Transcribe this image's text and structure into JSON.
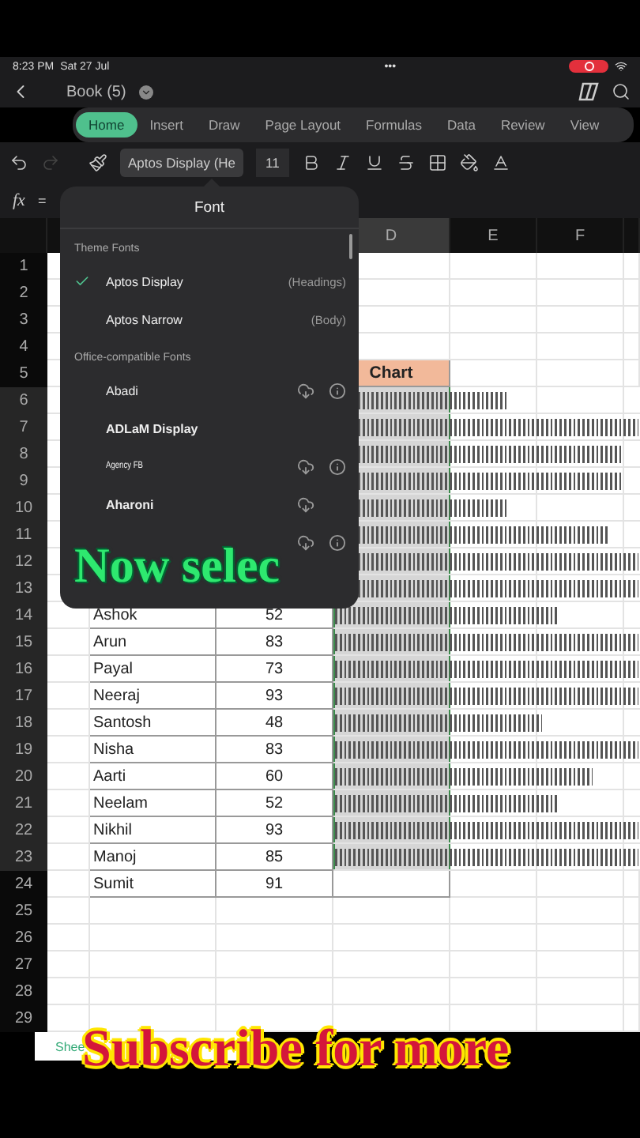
{
  "status_bar": {
    "time": "8:23 PM",
    "date": "Sat 27 Jul",
    "dots": "•••",
    "recording": true
  },
  "title_bar": {
    "title": "Book (5)"
  },
  "ribbon_tabs": [
    {
      "label": "Home",
      "selected": true
    },
    {
      "label": "Insert",
      "selected": false
    },
    {
      "label": "Draw",
      "selected": false
    },
    {
      "label": "Page Layout",
      "selected": false
    },
    {
      "label": "Formulas",
      "selected": false
    },
    {
      "label": "Data",
      "selected": false
    },
    {
      "label": "Review",
      "selected": false
    },
    {
      "label": "View",
      "selected": false
    }
  ],
  "toolbar": {
    "redo_disabled": true,
    "font": "Aptos Display (He",
    "size": "11"
  },
  "formula_bar": {
    "label": "fx",
    "value": "="
  },
  "columns": [
    {
      "letter": "D",
      "selected": true
    },
    {
      "letter": "E",
      "selected": false
    },
    {
      "letter": "F",
      "selected": false
    }
  ],
  "rows": [
    {
      "num": "1",
      "selected": false
    },
    {
      "num": "2",
      "selected": false
    },
    {
      "num": "3",
      "selected": false
    },
    {
      "num": "4",
      "selected": false
    },
    {
      "num": "5",
      "selected": false,
      "header": "Chart"
    },
    {
      "num": "6",
      "selected": true,
      "level": 0.57
    },
    {
      "num": "7",
      "selected": true,
      "level": 1
    },
    {
      "num": "8",
      "selected": true,
      "level": 0.95
    },
    {
      "num": "9",
      "selected": true,
      "level": 0.95
    },
    {
      "num": "10",
      "selected": true,
      "level": 0.57
    },
    {
      "num": "11",
      "selected": true,
      "level": 0.9
    },
    {
      "num": "12",
      "selected": true,
      "level": 1
    },
    {
      "num": "13",
      "selected": true,
      "level": 1
    },
    {
      "num": "14",
      "selected": true,
      "name": "Ashok",
      "score": "52",
      "level": 0.74
    },
    {
      "num": "15",
      "selected": true,
      "name": "Arun",
      "score": "83",
      "level": 1
    },
    {
      "num": "16",
      "selected": true,
      "name": "Payal",
      "score": "73",
      "level": 1
    },
    {
      "num": "17",
      "selected": true,
      "name": "Neeraj",
      "score": "93",
      "level": 1
    },
    {
      "num": "18",
      "selected": true,
      "name": "Santosh",
      "score": "48",
      "level": 0.68
    },
    {
      "num": "19",
      "selected": true,
      "name": "Nisha",
      "score": "83",
      "level": 1
    },
    {
      "num": "20",
      "selected": true,
      "name": "Aarti",
      "score": "60",
      "level": 0.85
    },
    {
      "num": "21",
      "selected": true,
      "name": "Neelam",
      "score": "52",
      "level": 0.74
    },
    {
      "num": "22",
      "selected": true,
      "name": "Nikhil",
      "score": "93",
      "level": 1
    },
    {
      "num": "23",
      "selected": true,
      "name": "Manoj",
      "score": "85",
      "level": 1
    },
    {
      "num": "24",
      "selected": false,
      "name": "Sumit",
      "score": "91"
    },
    {
      "num": "25",
      "selected": false
    },
    {
      "num": "26",
      "selected": false
    },
    {
      "num": "27",
      "selected": false
    },
    {
      "num": "28",
      "selected": false
    },
    {
      "num": "29",
      "selected": false
    }
  ],
  "sheet_tab": "Shee",
  "font_popup": {
    "title": "Font",
    "sections": [
      {
        "heading": "Theme Fonts",
        "items": [
          {
            "name": "Aptos Display",
            "note": "(Headings)",
            "selected": true,
            "kind": "regular"
          },
          {
            "name": "Aptos Narrow",
            "note": "(Body)",
            "selected": false,
            "kind": "regular"
          }
        ]
      },
      {
        "heading": "Office-compatible Fonts",
        "items": [
          {
            "name": "Abadi",
            "selected": false,
            "kind": "regular",
            "download": true,
            "info": true
          },
          {
            "name": "ADLaM Display",
            "selected": false,
            "kind": "bold",
            "download": false,
            "info": false
          },
          {
            "name": "Agency FB",
            "selected": false,
            "kind": "condensed",
            "download": true,
            "info": true
          },
          {
            "name": "Aharoni",
            "selected": false,
            "kind": "bold",
            "download": true,
            "info": false
          },
          {
            "selected": false,
            "download": true,
            "info": true
          }
        ]
      }
    ]
  },
  "captions": [
    {
      "text": "Now selec",
      "kind": "green"
    },
    {
      "text": "Subscribe for more",
      "kind": "red"
    }
  ]
}
